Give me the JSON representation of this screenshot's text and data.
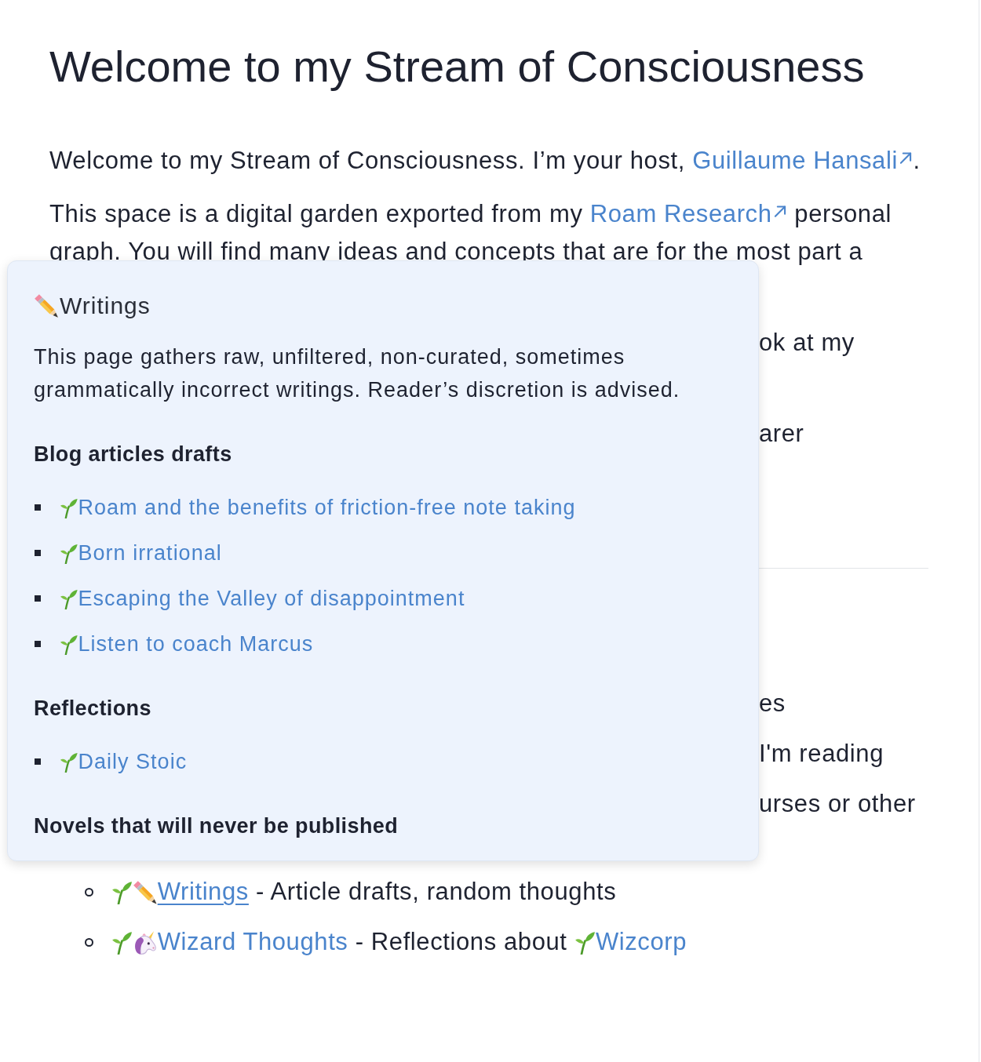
{
  "page_title": "Welcome to my Stream of Consciousness",
  "intro": [
    {
      "text": "Welcome to my Stream of Consciousness. I’m your host, "
    },
    {
      "link": {
        "text": "Guillaume Hansali",
        "external": true
      }
    },
    {
      "text": "."
    }
  ],
  "garden_paragraph": {
    "lines": [
      [
        {
          "text": "This space is a digital garden exported from my "
        },
        {
          "link": {
            "text": "Roam Research",
            "external": true
          }
        },
        {
          "text": " personal"
        }
      ],
      [
        {
          "text": "graph. You will find many ideas and concepts that are for the most part a"
        }
      ]
    ]
  },
  "obscured_paragraph_ends": [
    "ok at my",
    "arer"
  ],
  "obscured_list_item_ends": [
    "es",
    "I'm reading",
    "urses or other"
  ],
  "popover": {
    "title": {
      "kind": "pencil",
      "text": "Writings"
    },
    "description": "This page gathers raw, unfiltered, non-curated, sometimes grammatically incorrect writings. Reader’s discretion is advised.",
    "sections": [
      {
        "heading": "Blog articles drafts",
        "items": [
          {
            "text": "Roam and the benefits of friction-free note taking",
            "seedling": true
          },
          {
            "text": "Born irrational",
            "seedling": true
          },
          {
            "text": "Escaping the Valley of disappointment",
            "seedling": true
          },
          {
            "text": "Listen to coach Marcus",
            "seedling": true
          }
        ]
      },
      {
        "heading": "Reflections",
        "items": [
          {
            "text": "Daily Stoic",
            "seedling": true
          }
        ]
      },
      {
        "heading": "Novels that will never be published"
      }
    ]
  },
  "page_list": [
    {
      "segments": [
        {
          "link": {
            "text": "Writings",
            "seedling": true,
            "kind": "pencil",
            "hovered": true
          }
        },
        {
          "text": " - Article drafts, random thoughts"
        }
      ]
    },
    {
      "segments": [
        {
          "link": {
            "text": "Wizard Thoughts",
            "seedling": true,
            "kind": "unicorn",
            "hovered": false
          }
        },
        {
          "text": " - Reflections about "
        },
        {
          "link": {
            "text": "Wizcorp",
            "seedling": true,
            "hovered": false
          }
        }
      ]
    }
  ]
}
